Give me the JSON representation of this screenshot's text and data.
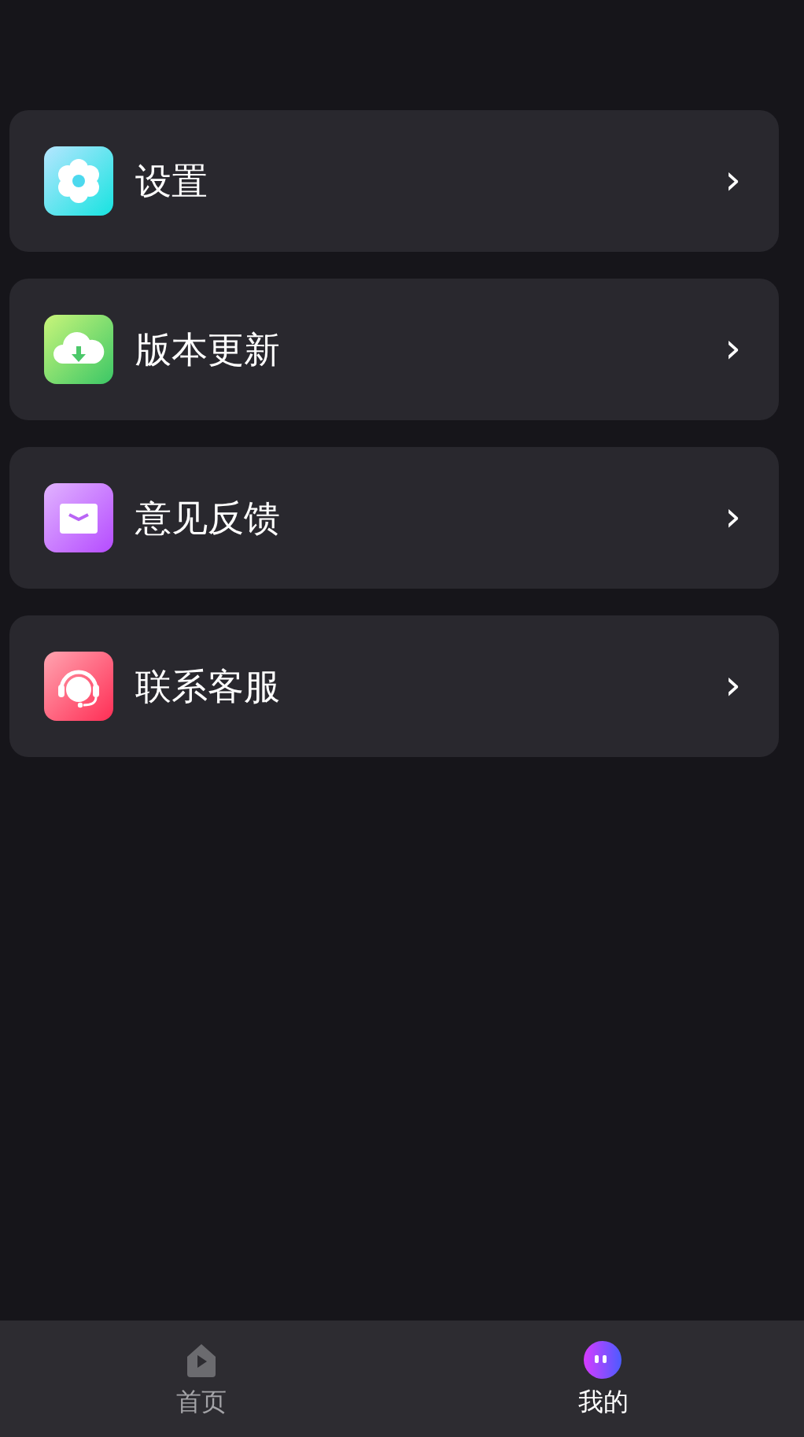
{
  "menu": [
    {
      "kind": "settings",
      "label": "设置",
      "chevron": "›"
    },
    {
      "kind": "update",
      "label": "版本更新",
      "chevron": "›"
    },
    {
      "kind": "feedback",
      "label": "意见反馈",
      "chevron": "›"
    },
    {
      "kind": "support",
      "label": "联系客服",
      "chevron": "›"
    }
  ],
  "tab_bar": [
    {
      "kind": "home",
      "label": "首页",
      "selected": false
    },
    {
      "kind": "mine",
      "label": "我的",
      "selected": true
    }
  ]
}
